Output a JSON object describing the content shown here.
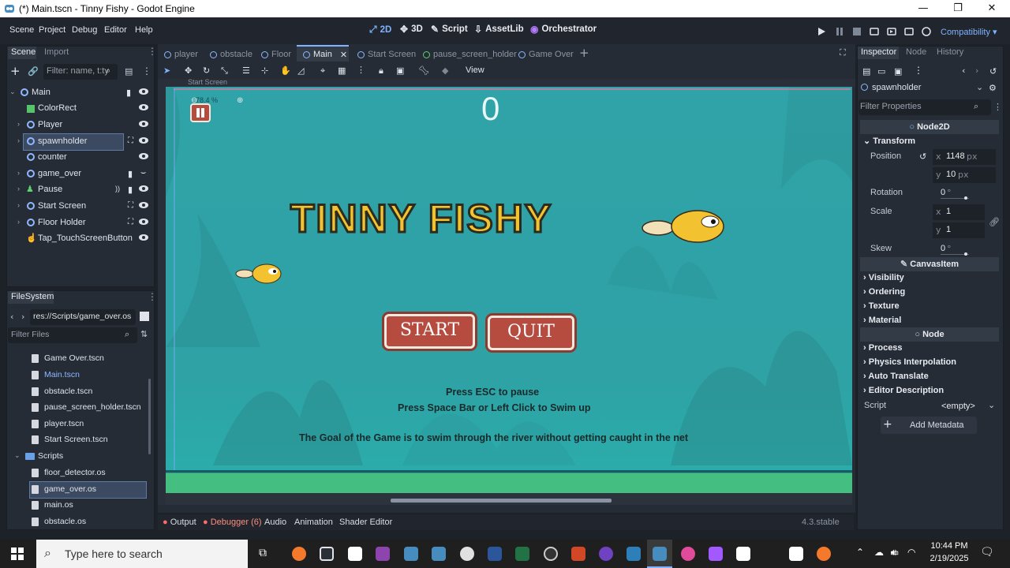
{
  "window": {
    "title": "(*) Main.tscn - Tinny Fishy - Godot Engine"
  },
  "menu": {
    "items": [
      "Scene",
      "Project",
      "Debug",
      "Editor",
      "Help"
    ]
  },
  "workspaces": {
    "w2d": "2D",
    "w3d": "3D",
    "script": "Script",
    "assetlib": "AssetLib",
    "plugin": "Orchestrator"
  },
  "renderer": "Compatibility",
  "scene_dock": {
    "tabs": [
      "Scene",
      "Import"
    ],
    "filter_placeholder": "Filter: name, t:ty",
    "nodes": [
      {
        "name": "Main"
      },
      {
        "name": "ColorRect"
      },
      {
        "name": "Player"
      },
      {
        "name": "spawnholder"
      },
      {
        "name": "counter"
      },
      {
        "name": "game_over"
      },
      {
        "name": "Pause"
      },
      {
        "name": "Start Screen"
      },
      {
        "name": "Floor Holder"
      },
      {
        "name": "Tap_TouchScreenButton"
      }
    ]
  },
  "filesystem": {
    "title": "FileSystem",
    "path": "res://Scripts/game_over.os",
    "filter_placeholder": "Filter Files",
    "files": [
      {
        "name": "Game Over.tscn"
      },
      {
        "name": "Main.tscn"
      },
      {
        "name": "obstacle.tscn"
      },
      {
        "name": "pause_screen_holder.tscn"
      },
      {
        "name": "player.tscn"
      },
      {
        "name": "Start Screen.tscn"
      }
    ],
    "folder": "Scripts",
    "scripts": [
      {
        "name": "floor_detector.os"
      },
      {
        "name": "game_over.os"
      },
      {
        "name": "main.os"
      },
      {
        "name": "obstacle.os"
      }
    ]
  },
  "editor_tabs": [
    "player",
    "obstacle",
    "Floor",
    "Main",
    "Start Screen",
    "pause_screen_holder",
    "Game Over"
  ],
  "toolbar": {
    "view": "View"
  },
  "viewport": {
    "breadcrumb": "Start Screen",
    "zoom": "78.4 %",
    "score": "0",
    "game_title": "TINNY FISHY",
    "start_button": "START",
    "quit_button": "QUIT",
    "hint1": "Press ESC to pause",
    "hint2": "Press Space  Bar or Left Click to Swim up",
    "goal": "The Goal  of the Game is to swim through the river without getting caught in the net"
  },
  "inspector": {
    "tabs": [
      "Inspector",
      "Node",
      "History"
    ],
    "node_name": "spawnholder",
    "filter_placeholder": "Filter Properties",
    "class_node2d": "Node2D",
    "transform": "Transform",
    "position_label": "Position",
    "pos_x": "1148",
    "pos_y": "10",
    "unit_px": "px",
    "rotation_label": "Rotation",
    "rotation_value": "0",
    "unit_deg": "°",
    "scale_label": "Scale",
    "scale_x": "1",
    "scale_y": "1",
    "skew_label": "Skew",
    "skew_value": "0",
    "class_canvas": "CanvasItem",
    "canvas_sections": [
      "Visibility",
      "Ordering",
      "Texture",
      "Material"
    ],
    "class_node": "Node",
    "node_sections": [
      "Process",
      "Physics Interpolation",
      "Auto Translate",
      "Editor Description"
    ],
    "script_label": "Script",
    "script_value": "<empty>",
    "add_metadata": "Add Metadata"
  },
  "bottom_panel": {
    "tabs": [
      "Output",
      "Debugger (6)",
      "Audio",
      "Animation",
      "Shader Editor"
    ],
    "version": "4.3.stable"
  },
  "taskbar": {
    "search_placeholder": "Type here to search",
    "time": "10:44 PM",
    "date": "2/19/2025"
  },
  "colors": {
    "accent": "#7fb2ff",
    "viewport_bg": "#2b9aa0",
    "button_red": "#b64c40",
    "title_yellow": "#f2c230"
  }
}
